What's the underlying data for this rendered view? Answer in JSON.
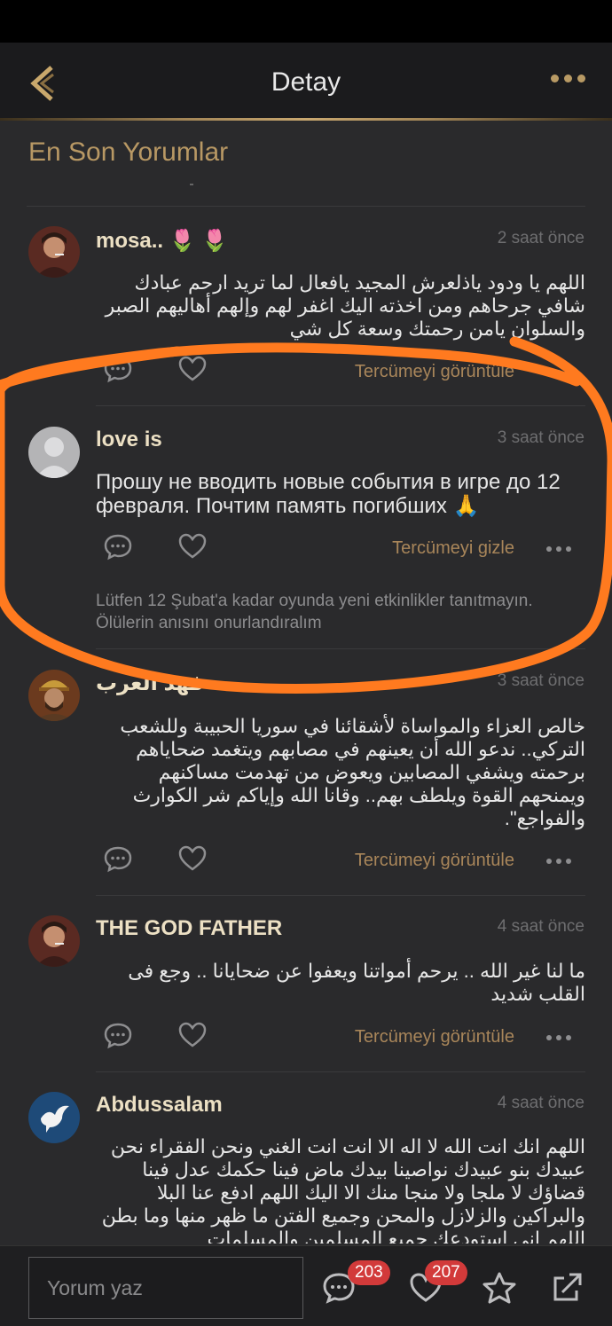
{
  "header": {
    "title": "Detay"
  },
  "section": {
    "title": "En Son Yorumlar"
  },
  "comments": [
    {
      "username": "mosa.. 🌷 🌷",
      "time": "2 saat önce",
      "text": "اللهم يا ودود ياذلعرش المجيد يافعال لما تريد ارحم عبادك شافي جرحاهم ومن اخذته اليك اغفر لهم وإلهم أهاليهم الصبر والسلوان يامن رحمتك وسعة كل شي",
      "translate_label": "Tercümeyi görüntüle",
      "avatar": "man-portrait"
    },
    {
      "username": "love is",
      "time": "3 saat önce",
      "text": "Прошу не вводить новые события в игре до 12 февраля. Почтим память погибших 🙏",
      "translate_label": "Tercümeyi gizle",
      "translation": "Lütfen 12 Şubat'a kadar oyunda yeni etkinlikler tanıtmayın. Ölülerin anısını onurlandıralım",
      "avatar": "default-user"
    },
    {
      "username": "فهد العرب",
      "time": "3 saat önce",
      "text": "خالص العزاء والمواساة لأشقائنا في سوريا الحبيبة وللشعب التركي.. ندعو الله أن يعينهم في مصابهم ويتغمد ضحاياهم برحمته ويشفي المصابين ويعوض من تهدمت مساكنهم ويمنحهم القوة ويلطف بهم.. وقانا الله وإياكم شر الكوارث والفواجع\".",
      "translate_label": "Tercümeyi görüntüle",
      "avatar": "warrior-portrait"
    },
    {
      "username": "THE GOD FATHER",
      "time": "4 saat önce",
      "text": "ما لنا غير الله .. يرحم أمواتنا ويعفوا عن ضحايانا .. وجع فى القلب شديد",
      "translate_label": "Tercümeyi görüntüle",
      "avatar": "man-portrait"
    },
    {
      "username": "Abdussalam",
      "time": "4 saat önce",
      "text": "اللهم انك انت الله لا اله الا انت انت الغني ونحن الفقراء نحن عبيدك بنو عبيدك نواصينا بيدك ماض فينا حكمك عدل فينا قضاؤك لا ملجا ولا منجا منك الا اليك اللهم ادفع عنا البلا والبراكين والزلازل والمحن وجميع الفتن ما ظهر منها وما بطن اللهم اني استودعك جميع المسلمين والمسلمات",
      "avatar": "dove-logo"
    }
  ],
  "bottom_bar": {
    "input_placeholder": "Yorum yaz",
    "comments_count": "203",
    "likes_count": "207"
  },
  "colors": {
    "accent_gold": "#b89864",
    "badge_red": "#d23a3a",
    "annotation_orange": "#ff7a1f",
    "background": "#2a2a2c"
  }
}
